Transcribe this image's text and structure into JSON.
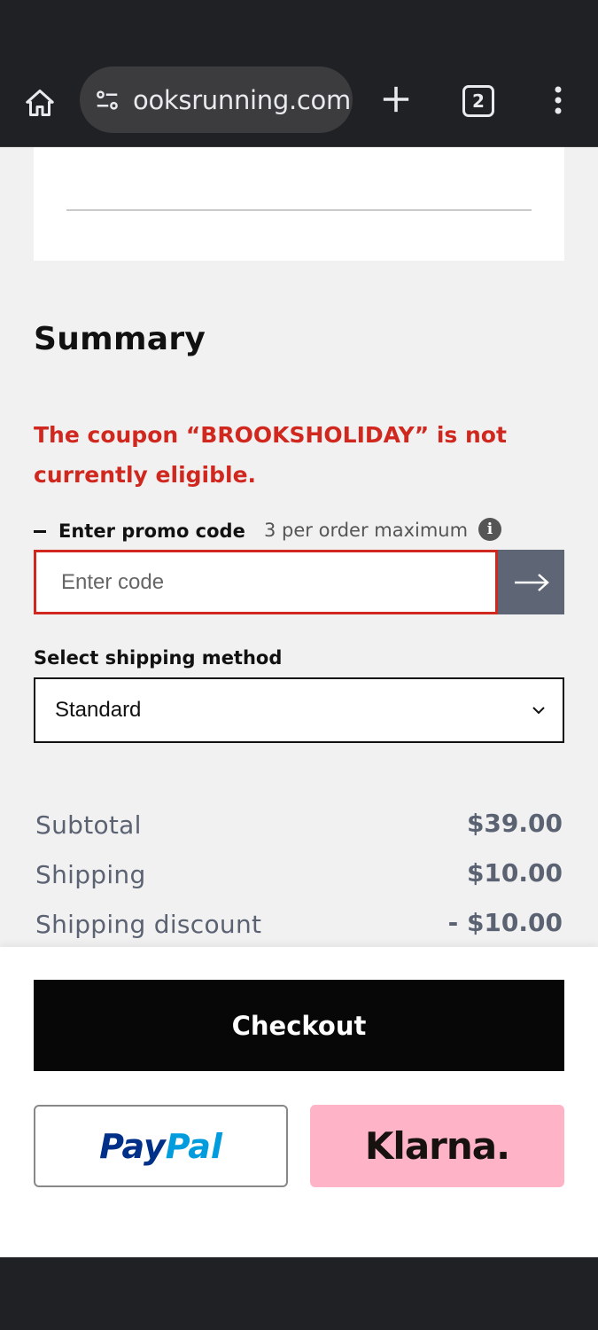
{
  "browser": {
    "url": "ooksrunning.com",
    "tab_count": "2"
  },
  "summary": {
    "title": "Summary",
    "coupon_error": "The coupon “BROOKSHOLIDAY” is not currently eligible.",
    "promo": {
      "label": "Enter promo code",
      "max_note": "3 per order maximum",
      "placeholder": "Enter code",
      "value": ""
    },
    "shipping": {
      "label": "Select shipping method",
      "selected": "Standard"
    },
    "totals": [
      {
        "label": "Subtotal",
        "amount": "$39.00"
      },
      {
        "label": "Shipping",
        "amount": "$10.00"
      },
      {
        "label": "Shipping discount",
        "amount": "- $10.00"
      }
    ]
  },
  "footer": {
    "checkout_label": "Checkout",
    "paypal_part1": "Pay",
    "paypal_part2": "Pal",
    "klarna_label": "Klarna."
  },
  "colors": {
    "error": "#d0281e",
    "promo_submit_bg": "#5e6676",
    "checkout_bg": "#070707",
    "klarna_bg": "#ffb3c7",
    "paypal_dark": "#003087",
    "paypal_light": "#009cde"
  },
  "icons": {
    "home": "home-icon",
    "site_settings": "site-settings-icon",
    "new_tab": "plus-icon",
    "tabs": "tab-switcher-icon",
    "menu": "more-vert-icon",
    "info": "info-icon",
    "submit": "arrow-right-icon",
    "dropdown": "chevron-down-icon"
  }
}
